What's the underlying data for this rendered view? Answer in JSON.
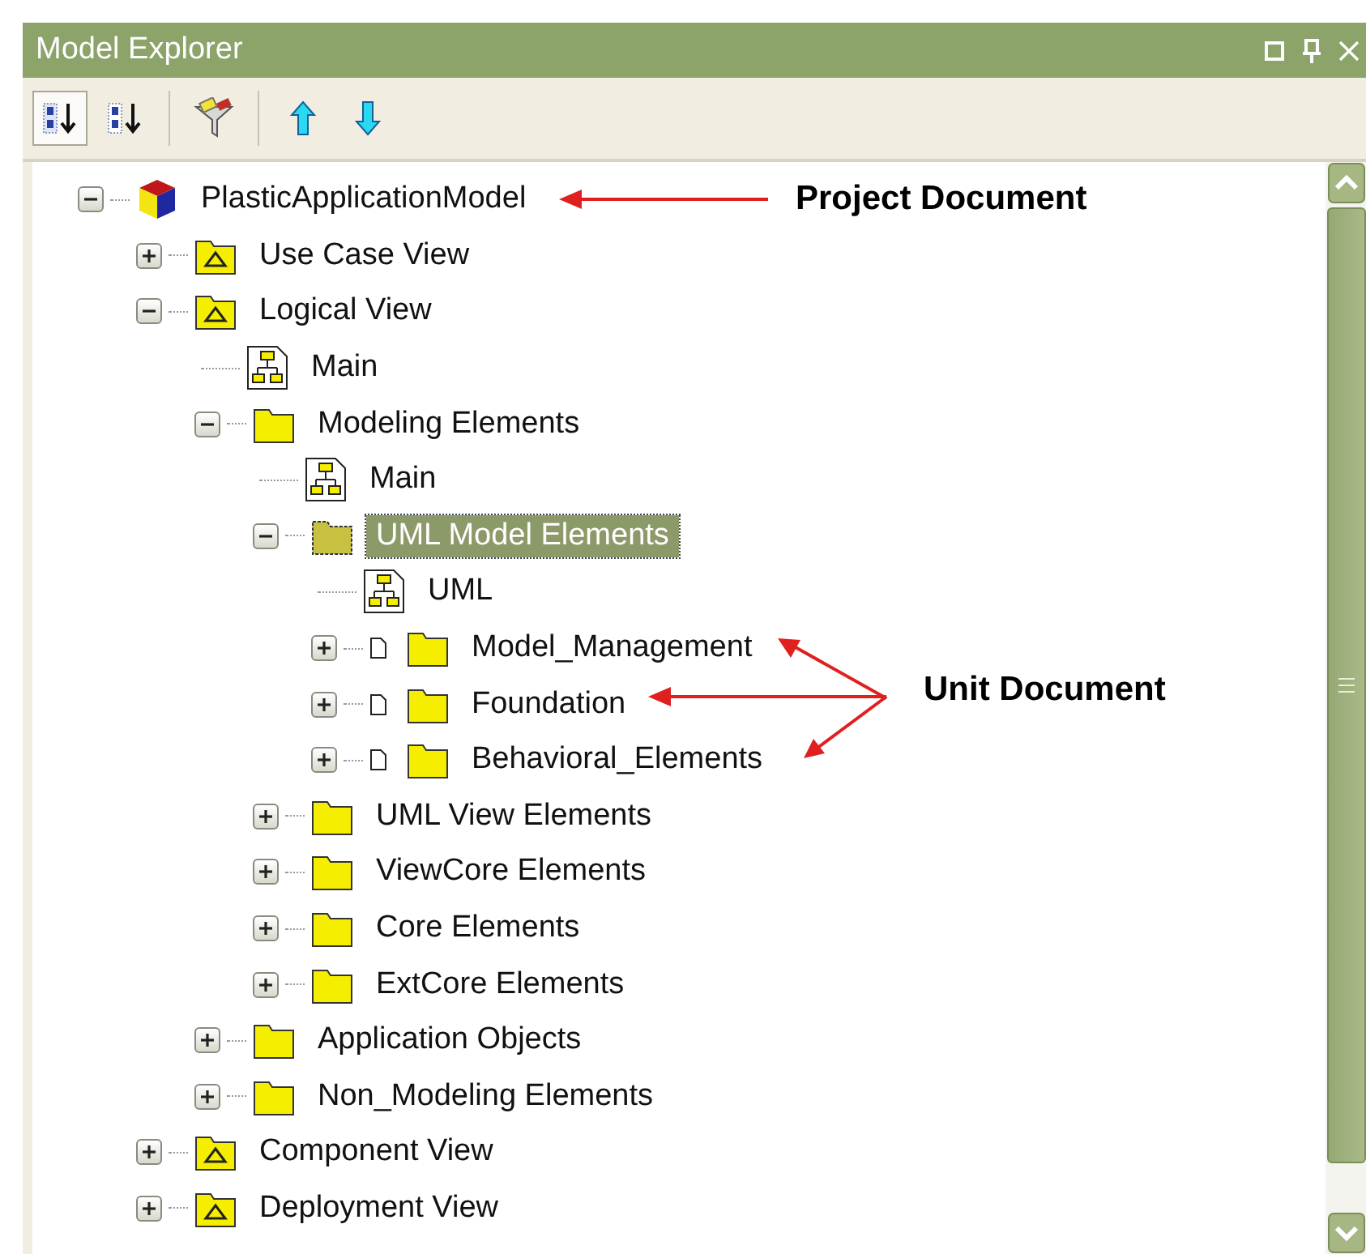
{
  "window": {
    "title": "Model Explorer"
  },
  "toolbar": [
    {
      "kind": "sort-numeric",
      "selected": true
    },
    {
      "kind": "sort-alpha",
      "selected": false
    },
    {
      "kind": "filter"
    },
    {
      "kind": "up"
    },
    {
      "kind": "down"
    }
  ],
  "tree": [
    {
      "label": "PlasticApplicationModel",
      "kind": "project",
      "expanded": true,
      "selected": false,
      "children": [
        {
          "label": "Use Case View",
          "kind": "view",
          "expanded": false,
          "selected": false
        },
        {
          "label": "Logical View",
          "kind": "view",
          "expanded": true,
          "selected": false,
          "children": [
            {
              "label": "Main",
              "kind": "diagram",
              "selected": false
            },
            {
              "label": "Modeling Elements",
              "kind": "folder",
              "expanded": true,
              "selected": false,
              "children": [
                {
                  "label": "Main",
                  "kind": "diagram",
                  "selected": false
                },
                {
                  "label": "UML Model Elements",
                  "kind": "folder",
                  "expanded": true,
                  "selected": true,
                  "children": [
                    {
                      "label": "UML",
                      "kind": "diagram",
                      "selected": false
                    },
                    {
                      "label": "Model_Management",
                      "kind": "unit",
                      "expanded": false,
                      "selected": false
                    },
                    {
                      "label": "Foundation",
                      "kind": "unit",
                      "expanded": false,
                      "selected": false
                    },
                    {
                      "label": "Behavioral_Elements",
                      "kind": "unit",
                      "expanded": false,
                      "selected": false
                    }
                  ]
                },
                {
                  "label": "UML View Elements",
                  "kind": "folder",
                  "expanded": false,
                  "selected": false
                },
                {
                  "label": "ViewCore Elements",
                  "kind": "folder",
                  "expanded": false,
                  "selected": false
                },
                {
                  "label": "Core Elements",
                  "kind": "folder",
                  "expanded": false,
                  "selected": false
                },
                {
                  "label": "ExtCore Elements",
                  "kind": "folder",
                  "expanded": false,
                  "selected": false
                }
              ]
            },
            {
              "label": "Application Objects",
              "kind": "folder",
              "expanded": false,
              "selected": false
            },
            {
              "label": "Non_Modeling Elements",
              "kind": "folder",
              "expanded": false,
              "selected": false
            }
          ]
        },
        {
          "label": "Component View",
          "kind": "view",
          "expanded": false,
          "selected": false
        },
        {
          "label": "Deployment View",
          "kind": "view",
          "expanded": false,
          "selected": false
        }
      ]
    }
  ],
  "annotations": [
    {
      "text": "Project Document"
    },
    {
      "text": "Unit Document"
    }
  ]
}
